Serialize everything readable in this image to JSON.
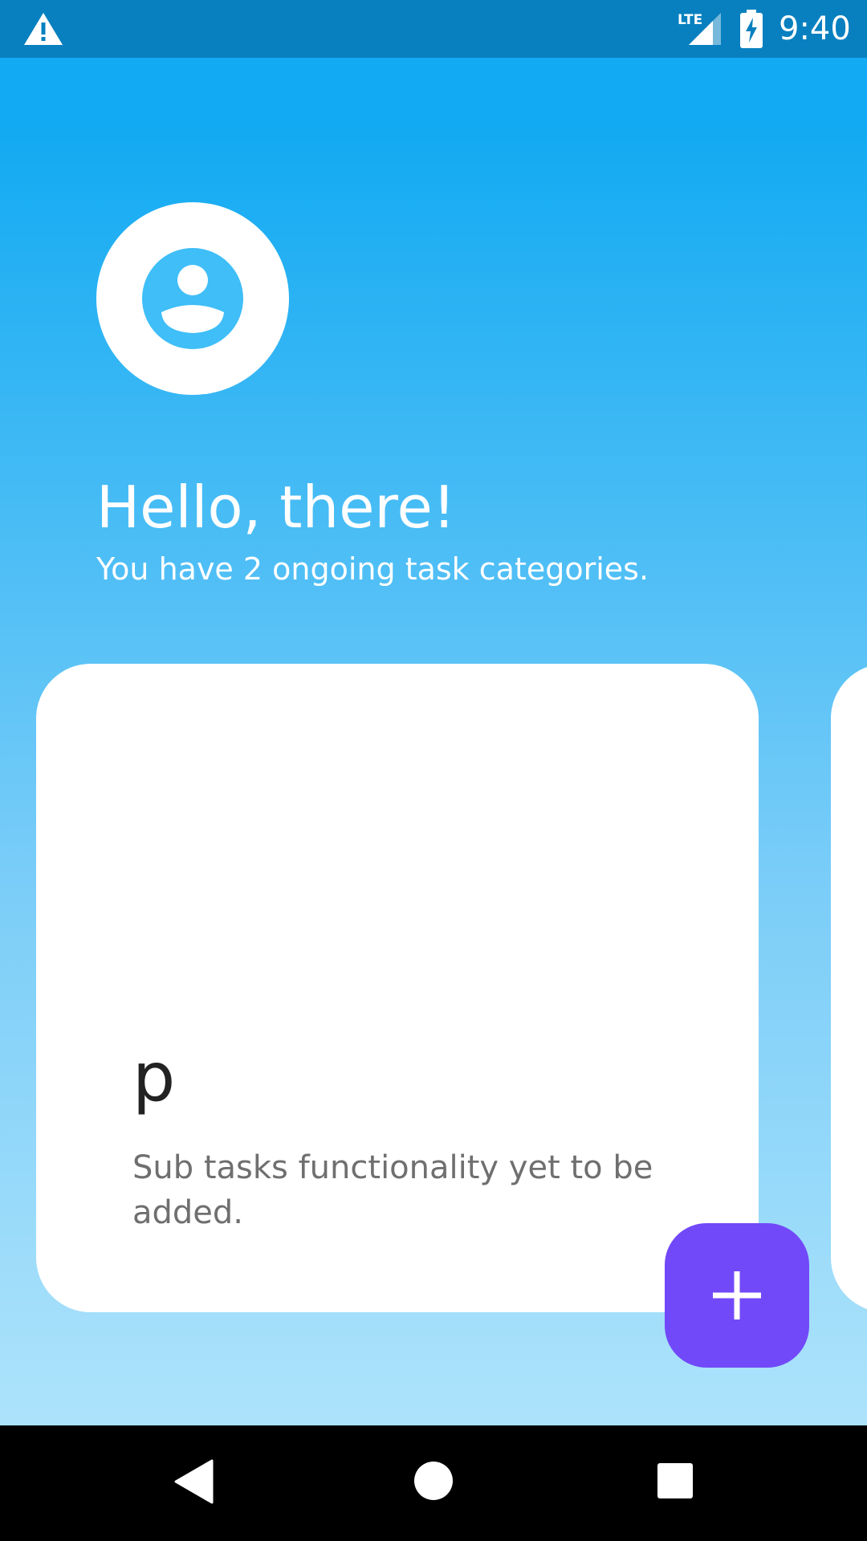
{
  "status_bar": {
    "time": "9:40",
    "network": "LTE",
    "icons": [
      "warning-icon",
      "lte-signal-icon",
      "battery-charging-icon"
    ]
  },
  "header": {
    "greeting": "Hello, there!",
    "subtitle": "You have 2 ongoing task categories."
  },
  "cards": [
    {
      "title": "p",
      "description": "Sub tasks functionality yet to be added."
    }
  ],
  "fab": {
    "icon": "plus-icon",
    "color": "#7249f8"
  },
  "nav_bar": {
    "icons": [
      "back-icon",
      "home-icon",
      "recents-icon"
    ]
  },
  "colors": {
    "status_bar": "#0880bf",
    "background_top": "#12aaf2",
    "background_bottom": "#ade3fb",
    "avatar_icon": "#3fbef8",
    "card": "#ffffff",
    "card_title": "#222222",
    "card_description": "#6f6f6f"
  }
}
